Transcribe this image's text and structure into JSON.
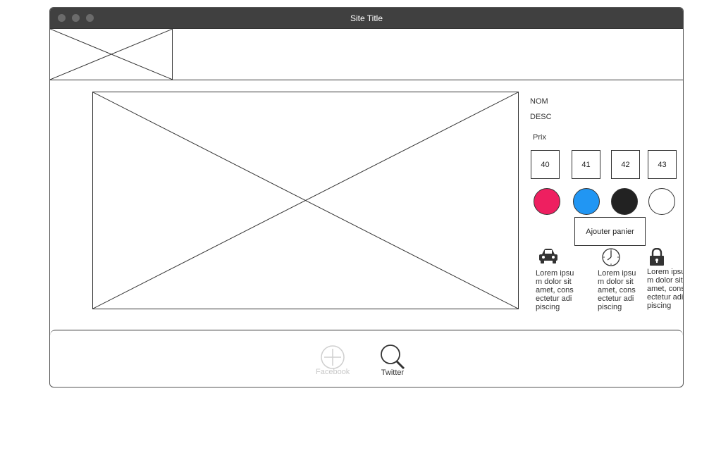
{
  "window": {
    "title": "Site Title"
  },
  "product": {
    "name_label": "NOM",
    "desc_label": "DESC",
    "price_label": "Prix",
    "sizes": [
      "40",
      "41",
      "42",
      "43"
    ],
    "colors": [
      {
        "name": "pink",
        "hex": "#ee1f60"
      },
      {
        "name": "blue",
        "hex": "#2196f3"
      },
      {
        "name": "black",
        "hex": "#222222"
      },
      {
        "name": "white",
        "hex": "#ffffff"
      }
    ],
    "add_to_cart_label": "Ajouter panier"
  },
  "features": [
    {
      "icon": "car-icon",
      "text": "Lorem ipsum dolor sit amet, consectetur adipiscing"
    },
    {
      "icon": "clock-icon",
      "text": "Lorem ipsum dolor sit amet, consectetur adipiscing"
    },
    {
      "icon": "lock-icon",
      "text": "Lorem ipsum dolor sit amet, consectetur adipiscing"
    }
  ],
  "footer": {
    "social": [
      {
        "icon": "plus-circle-icon",
        "label": "Facebook"
      },
      {
        "icon": "search-icon",
        "label": "Twitter"
      }
    ]
  }
}
